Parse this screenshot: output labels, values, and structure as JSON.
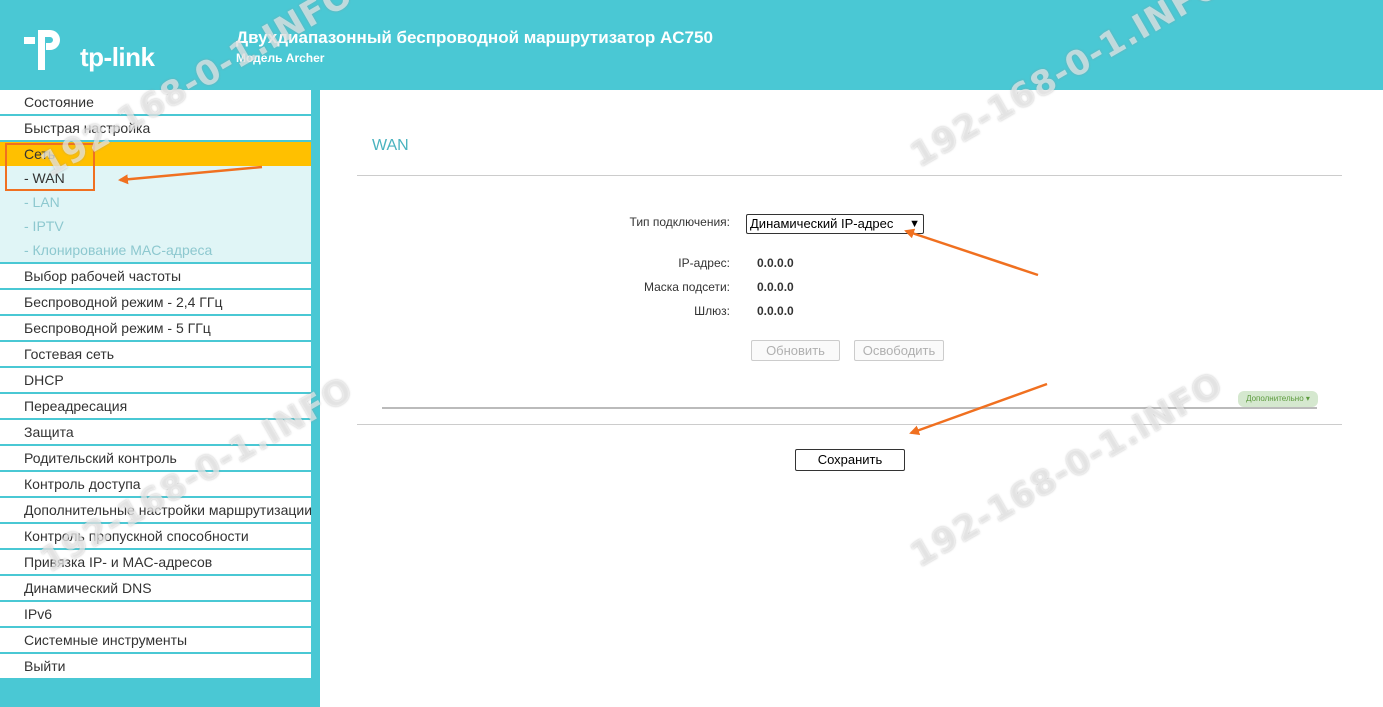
{
  "header": {
    "brand": "tp-link",
    "title": "Двухдиапазонный беспроводной маршрутизатор AC750",
    "subtitle": "Модель Archer"
  },
  "sidebar": {
    "items": [
      {
        "label": "Состояние"
      },
      {
        "label": "Быстрая настройка"
      },
      {
        "label": "Сеть",
        "active": true
      },
      {
        "label": "Выбор рабочей частоты"
      },
      {
        "label": "Беспроводной режим - 2,4 ГГц"
      },
      {
        "label": "Беспроводной режим - 5 ГГц"
      },
      {
        "label": "Гостевая сеть"
      },
      {
        "label": "DHCP"
      },
      {
        "label": "Переадресация"
      },
      {
        "label": "Защита"
      },
      {
        "label": "Родительский контроль"
      },
      {
        "label": "Контроль доступа"
      },
      {
        "label": "Дополнительные настройки маршрутизации"
      },
      {
        "label": "Контроль пропускной способности"
      },
      {
        "label": "Привязка IP- и MAC-адресов"
      },
      {
        "label": "Динамический DNS"
      },
      {
        "label": "IPv6"
      },
      {
        "label": "Системные инструменты"
      },
      {
        "label": "Выйти"
      }
    ],
    "subitems": [
      {
        "label": "- WAN",
        "active": true
      },
      {
        "label": "- LAN"
      },
      {
        "label": "- IPTV"
      },
      {
        "label": "- Клонирование MAC-адреса"
      }
    ]
  },
  "main": {
    "section_title": "WAN",
    "connection_type_label": "Тип подключения:",
    "connection_type_value": "Динамический IP-адрес",
    "ip_label": "IP-адрес:",
    "ip_value": "0.0.0.0",
    "mask_label": "Маска подсети:",
    "mask_value": "0.0.0.0",
    "gateway_label": "Шлюз:",
    "gateway_value": "0.0.0.0",
    "renew_label": "Обновить",
    "release_label": "Освободить",
    "advanced_label": "Дополнительно",
    "save_label": "Сохранить"
  },
  "watermark": "192-168-0-1.INFO",
  "colors": {
    "accent": "#4ac8d4",
    "active_menu": "#ffc000",
    "annotation": "#f07020"
  }
}
